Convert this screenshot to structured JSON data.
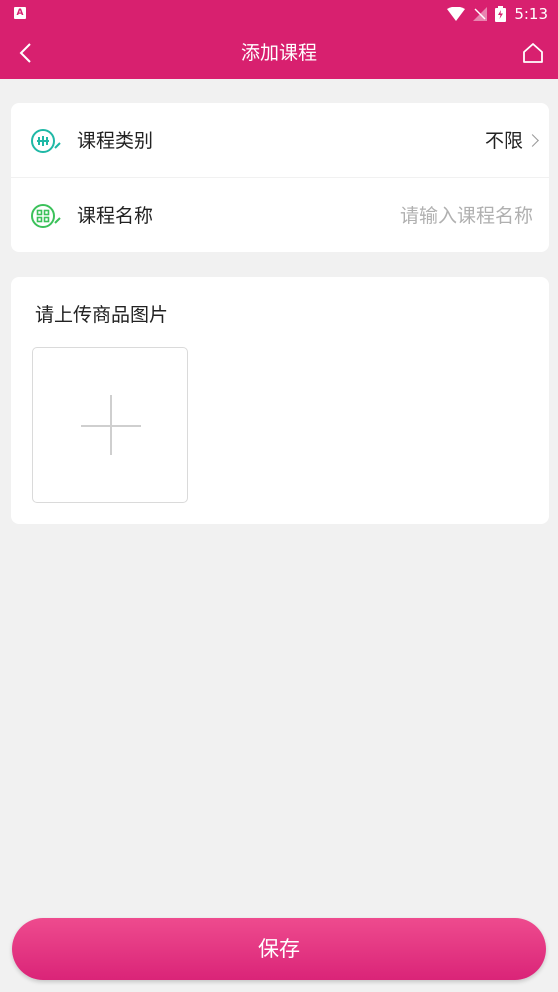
{
  "status_bar": {
    "indicator": "A",
    "time": "5:13"
  },
  "header": {
    "title": "添加课程"
  },
  "form": {
    "category": {
      "label": "课程类别",
      "value": "不限"
    },
    "name": {
      "label": "课程名称",
      "placeholder": "请输入课程名称"
    }
  },
  "upload": {
    "label": "请上传商品图片"
  },
  "footer": {
    "save_label": "保存"
  },
  "colors": {
    "primary": "#d8206f",
    "icon_teal": "#1fb8a6",
    "icon_green": "#3bc15a"
  },
  "icons": {
    "back": "chevron-left-icon",
    "home": "home-icon",
    "category": "category-icon",
    "name": "grid-edit-icon",
    "upload": "plus-icon"
  }
}
